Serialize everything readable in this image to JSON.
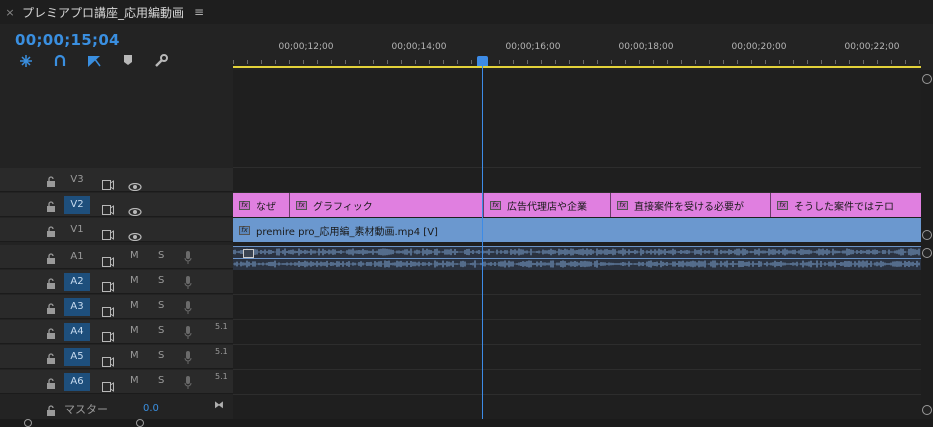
{
  "panel": {
    "close_glyph": "×",
    "title": "プレミアプロ講座_応用編動画",
    "menu_glyph": "≡"
  },
  "timecode": "00;00;15;04",
  "tools": [
    {
      "name": "snap-icon",
      "glyph": "⁑"
    },
    {
      "name": "linked-selection-icon",
      "glyph": "∩"
    },
    {
      "name": "add-marker-icon",
      "glyph": "◣"
    },
    {
      "name": "marker-icon",
      "glyph": "⬟"
    },
    {
      "name": "wrench-icon",
      "glyph": "🔧"
    }
  ],
  "ruler": {
    "labels": [
      "00;00;12;00",
      "00;00;14;00",
      "00;00;16;00",
      "00;00;18;00",
      "00;00;20;00",
      "00;00;22;00"
    ]
  },
  "video_tracks": [
    {
      "name": "V3",
      "targeted": false
    },
    {
      "name": "V2",
      "targeted": true
    },
    {
      "name": "V1",
      "targeted": false
    }
  ],
  "audio_tracks": [
    {
      "name": "A1",
      "targeted": false,
      "channel": "",
      "m": "M",
      "s": "S"
    },
    {
      "name": "A2",
      "targeted": true,
      "channel": "",
      "m": "M",
      "s": "S"
    },
    {
      "name": "A3",
      "targeted": true,
      "channel": "",
      "m": "M",
      "s": "S"
    },
    {
      "name": "A4",
      "targeted": true,
      "channel": "5.1",
      "m": "M",
      "s": "S"
    },
    {
      "name": "A5",
      "targeted": true,
      "channel": "5.1",
      "m": "M",
      "s": "S"
    },
    {
      "name": "A6",
      "targeted": true,
      "channel": "5.1",
      "m": "M",
      "s": "S"
    }
  ],
  "master": {
    "label": "マスター",
    "value": "0.0",
    "end_glyph": "⧓"
  },
  "v2_clips": [
    {
      "label": "なぜ"
    },
    {
      "label": "グラフィック"
    },
    {
      "label": "広告代理店や企業"
    },
    {
      "label": "直接案件を受ける必要が"
    },
    {
      "label": "そうした案件ではテロ"
    }
  ],
  "fx_glyph": "fx",
  "v1_clip": {
    "label": "premire pro_応用編_素材動画.mp4 [V]"
  },
  "colors": {
    "accent": "#3a8fe0",
    "title_clip": "#e07fe0",
    "video_clip": "#6b98cf",
    "work_area": "#e3d23a"
  }
}
